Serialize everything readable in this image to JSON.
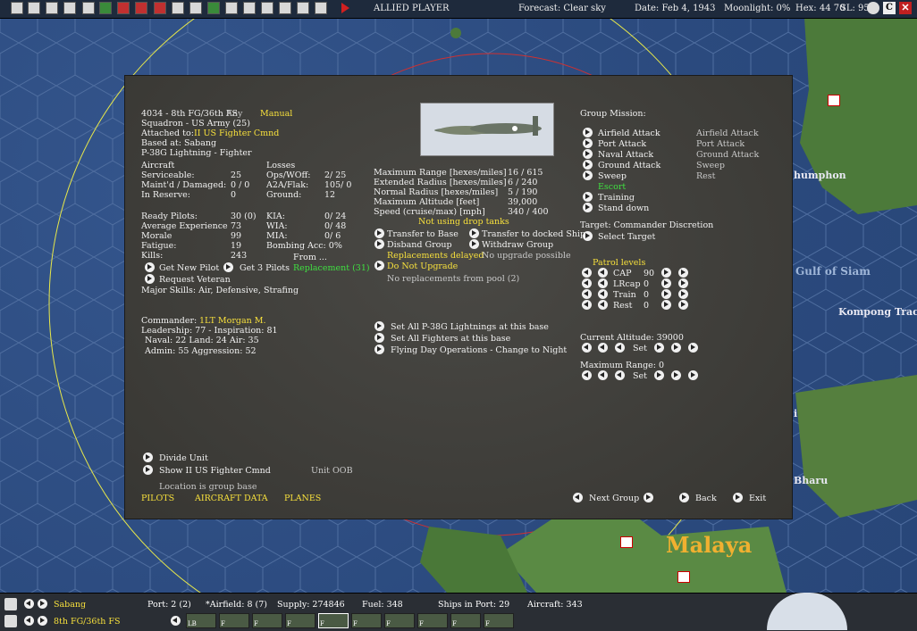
{
  "topbar": {
    "side": "ALLIED PLAYER",
    "forecast": "Forecast: Clear sky",
    "date": "Date: Feb 4, 1943",
    "moonlight": "Moonlight: 0%",
    "hex": "Hex: 44  70",
    "sl": "SL: 95",
    "c_label": "C"
  },
  "map_labels": {
    "humphon": "humphon",
    "gulf": "Gulf of Siam",
    "kompong": "Kompong Trac",
    "bharu": "Bharu",
    "malaya": "Malaya",
    "i": "i"
  },
  "unit": {
    "id_line": "4034 - 8th FG/36th FS",
    "any": "Any",
    "manual": "Manual",
    "squadron": "Squadron - US Army (25)",
    "attached_label": "Attached to:",
    "attached_value": "II US Fighter Cmnd",
    "based_at": "Based at: Sabang",
    "aircraft_type": "P-38G Lightning - Fighter"
  },
  "aircraft": {
    "header": "Aircraft",
    "serviceable_label": "Serviceable:",
    "serviceable_value": "25",
    "maintd_label": "Maint'd / Damaged:",
    "maintd_value": "0 / 0",
    "reserve_label": "In Reserve:",
    "reserve_value": "0"
  },
  "losses": {
    "header": "Losses",
    "ops_label": "Ops/WOff:",
    "ops_value": "2/ 25",
    "a2a_label": "A2A/Flak:",
    "a2a_value": "105/ 0",
    "ground_label": "Ground:",
    "ground_value": "12"
  },
  "pilots": {
    "ready_label": "Ready Pilots:",
    "ready_value": "30 (0)",
    "exp_label": "Average Experience",
    "exp_value": "73",
    "morale_label": "Morale",
    "morale_value": "99",
    "fatigue_label": "Fatigue:",
    "fatigue_value": "19",
    "kills_label": "Kills:",
    "kills_value": "243",
    "kia_label": "KIA:",
    "kia_value": "0/ 24",
    "wia_label": "WIA:",
    "wia_value": "0/ 48",
    "mia_label": "MIA:",
    "mia_value": "0/ 6",
    "bombing": "Bombing Acc: 0%",
    "from": "From ...",
    "replacement": "Replacement (31)",
    "get_new_pilot": "Get New Pilot",
    "get_3_pilots": "Get 3 Pilots",
    "request_veteran": "Request Veteran",
    "major_skills": "Major Skills:  Air, Defensive, Strafing"
  },
  "commander": {
    "label": "Commander:",
    "name": "1LT Morgan M.",
    "leadership": "Leadership: 77 - Inspiration: 81",
    "naval": "Naval:  22  Land:  24  Air:  35",
    "admin": "Admin:  55  Aggression:  52"
  },
  "specs": {
    "max_range_label": "Maximum Range [hexes/miles]",
    "max_range_value": "16 / 615",
    "ext_radius_label": "Extended Radius [hexes/miles]",
    "ext_radius_value": "6 / 240",
    "norm_radius_label": "Normal Radius [hexes/miles]",
    "norm_radius_value": "5 / 190",
    "max_alt_label": "Maximum Altitude [feet]",
    "max_alt_value": "39,000",
    "speed_label": "Speed (cruise/max) [mph]",
    "speed_value": "340 / 400",
    "drop_tanks": "Not using drop tanks"
  },
  "actions": {
    "transfer_base": "Transfer to Base",
    "transfer_ship": "Transfer to docked Ship",
    "disband": "Disband Group",
    "withdraw": "Withdraw Group",
    "replacements_delayed": "Replacements delayed",
    "no_upgrade_possible": "No upgrade possible",
    "do_not_upgrade": "Do Not Upgrade",
    "no_replacements": "No replacements from pool (2)",
    "set_all_p38": "Set All P-38G Lightnings at this base",
    "set_all_fighters": "Set All Fighters at this base",
    "flying_day": "Flying Day Operations - Change to Night"
  },
  "mission": {
    "header": "Group Mission:",
    "options": [
      "Airfield Attack",
      "Port Attack",
      "Naval Attack",
      "Ground Attack",
      "Sweep",
      "Escort",
      "Training",
      "Stand down"
    ],
    "secondary": [
      "Airfield Attack",
      "Port Attack",
      "Ground Attack",
      "Sweep",
      "Rest"
    ],
    "target": "Target: Commander Discretion",
    "select_target": "Select Target"
  },
  "patrol": {
    "header": "Patrol levels",
    "rows": [
      {
        "label": "CAP",
        "value": "90"
      },
      {
        "label": "LRcap",
        "value": "0"
      },
      {
        "label": "Train",
        "value": "0"
      },
      {
        "label": "Rest",
        "value": "0"
      }
    ],
    "current_altitude": "Current Altitude: 39000",
    "set": "Set",
    "maximum_range": "Maximum Range: 0"
  },
  "footer": {
    "divide_unit": "Divide Unit",
    "show_cmnd": "Show II US Fighter Cmnd",
    "unit_oob": "Unit OOB",
    "location": "Location is group base",
    "pilots_link": "PILOTS",
    "aircraft_data_link": "AIRCRAFT DATA",
    "planes_link": "PLANES",
    "next_group": "Next Group",
    "back": "Back",
    "exit": "Exit"
  },
  "bottombar": {
    "base": "Sabang",
    "group": "8th FG/36th FS",
    "port": "Port: 2 (2)",
    "airfield": "*Airfield: 8 (7)",
    "supply": "Supply: 274846",
    "fuel": "Fuel: 348",
    "ships": "Ships in Port: 29",
    "aircraft": "Aircraft: 343",
    "slots": [
      "LB",
      "F",
      "F",
      "F",
      "F",
      "F",
      "F",
      "F",
      "F",
      "F"
    ]
  }
}
